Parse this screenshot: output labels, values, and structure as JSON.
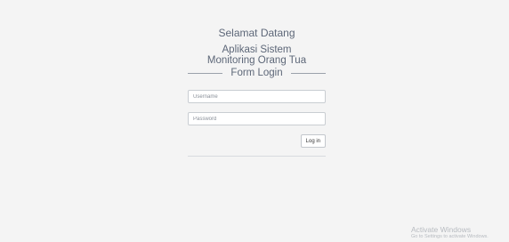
{
  "header": {
    "welcome": "Selamat Datang",
    "app_title_line1": "Aplikasi Sistem",
    "app_title_line2": "Monitoring Orang Tua"
  },
  "form": {
    "title": "Form Login",
    "username": {
      "placeholder": "Username",
      "value": ""
    },
    "password": {
      "placeholder": "Password",
      "value": ""
    },
    "login_label": "Log in"
  },
  "watermark": {
    "title": "Activate Windows",
    "subtitle": "Go to Settings to activate Windows."
  }
}
